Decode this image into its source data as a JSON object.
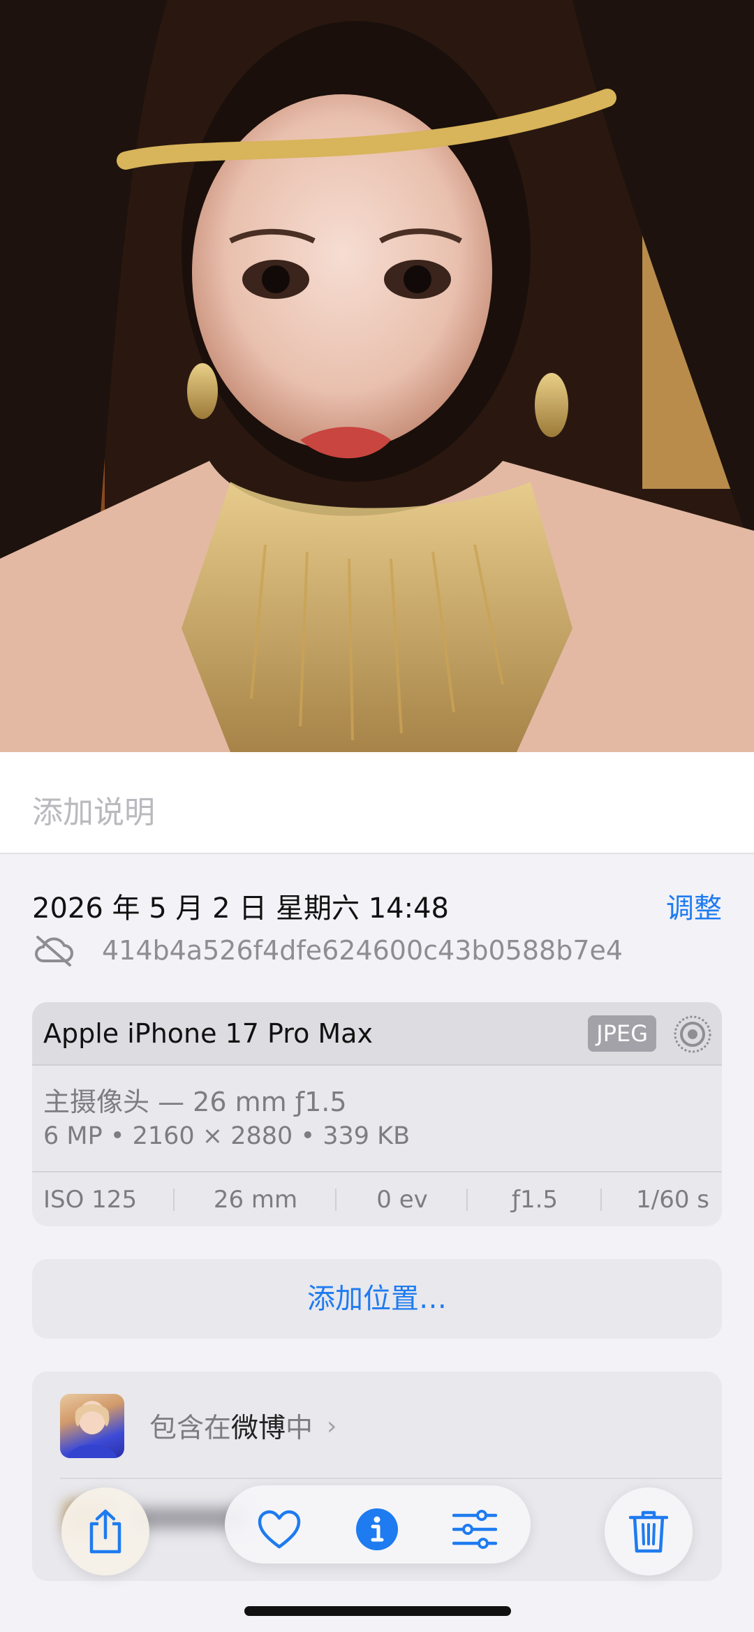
{
  "photo": {
    "alt_icon": "portrait-photo"
  },
  "caption": {
    "placeholder": "添加说明"
  },
  "meta": {
    "datetime": "2026 年 5 月 2 日 星期六 14:48",
    "adjust_label": "调整",
    "asset_id": "414b4a526f4dfe624600c43b0588b7e4",
    "cloud_icon": "cloud-off-icon"
  },
  "device": {
    "name": "Apple iPhone 17 Pro Max",
    "format_badge": "JPEG",
    "lens": "主摄像头 — 26 mm ƒ1.5",
    "specs": "6 MP • 2160 × 2880 • 339 KB",
    "exif": [
      "ISO 125",
      "26 mm",
      "0 ev",
      "ƒ1.5",
      "1/60 s"
    ]
  },
  "location": {
    "add_label": "添加位置…"
  },
  "album": {
    "prefix": "包含在",
    "name": "微博",
    "suffix": "中",
    "chevron": "›"
  },
  "toolbar": {
    "share": "share-icon",
    "favorite": "heart-icon",
    "info": "info-icon",
    "adjust": "sliders-icon",
    "delete": "trash-icon"
  },
  "colors": {
    "accent": "#1e7bf0",
    "secondary_text": "#7c7c82"
  }
}
